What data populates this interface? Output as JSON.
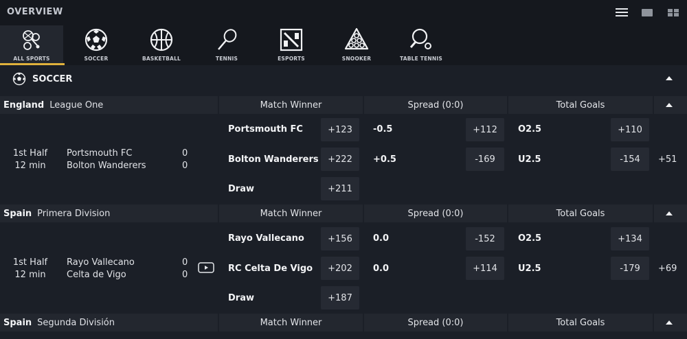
{
  "topbar": {
    "title": "OVERVIEW"
  },
  "sports": [
    {
      "label": "ALL SPORTS",
      "icon": "all-sports-icon"
    },
    {
      "label": "SOCCER",
      "icon": "soccer-ball-icon"
    },
    {
      "label": "BASKETBALL",
      "icon": "basketball-icon"
    },
    {
      "label": "TENNIS",
      "icon": "tennis-racket-icon"
    },
    {
      "label": "ESPORTS",
      "icon": "esports-icon"
    },
    {
      "label": "SNOOKER",
      "icon": "snooker-icon"
    },
    {
      "label": "TABLE TENNIS",
      "icon": "table-tennis-icon"
    }
  ],
  "section": {
    "title": "SOCCER"
  },
  "markets": {
    "match_winner": "Match Winner",
    "spread": "Spread (0:0)",
    "total_goals": "Total Goals"
  },
  "leagues": [
    {
      "country": "England",
      "name": "League One",
      "match": {
        "period": "1st Half",
        "clock": "12 min",
        "home": "Portsmouth FC",
        "away": "Bolton Wanderers",
        "home_score": "0",
        "away_score": "0",
        "winner": [
          {
            "name": "Portsmouth FC",
            "odds": "+123"
          },
          {
            "name": "Bolton Wanderers",
            "odds": "+222"
          },
          {
            "name": "Draw",
            "odds": "+211"
          }
        ],
        "spread": [
          {
            "line": "-0.5",
            "odds": "+112"
          },
          {
            "line": "+0.5",
            "odds": "-169"
          }
        ],
        "totals": [
          {
            "line": "O2.5",
            "odds": "+110"
          },
          {
            "line": "U2.5",
            "odds": "-154"
          }
        ],
        "more": "+51"
      }
    },
    {
      "country": "Spain",
      "name": "Primera Division",
      "match": {
        "period": "1st Half",
        "clock": "12 min",
        "home": "Rayo Vallecano",
        "away": "Celta de Vigo",
        "home_score": "0",
        "away_score": "0",
        "winner": [
          {
            "name": "Rayo Vallecano",
            "odds": "+156"
          },
          {
            "name": "RC Celta De Vigo",
            "odds": "+202"
          },
          {
            "name": "Draw",
            "odds": "+187"
          }
        ],
        "spread": [
          {
            "line": "0.0",
            "odds": "-152"
          },
          {
            "line": "0.0",
            "odds": "+114"
          }
        ],
        "totals": [
          {
            "line": "O2.5",
            "odds": "+134"
          },
          {
            "line": "U2.5",
            "odds": "-179"
          }
        ],
        "more": "+69"
      }
    },
    {
      "country": "Spain",
      "name": "Segunda División"
    }
  ]
}
